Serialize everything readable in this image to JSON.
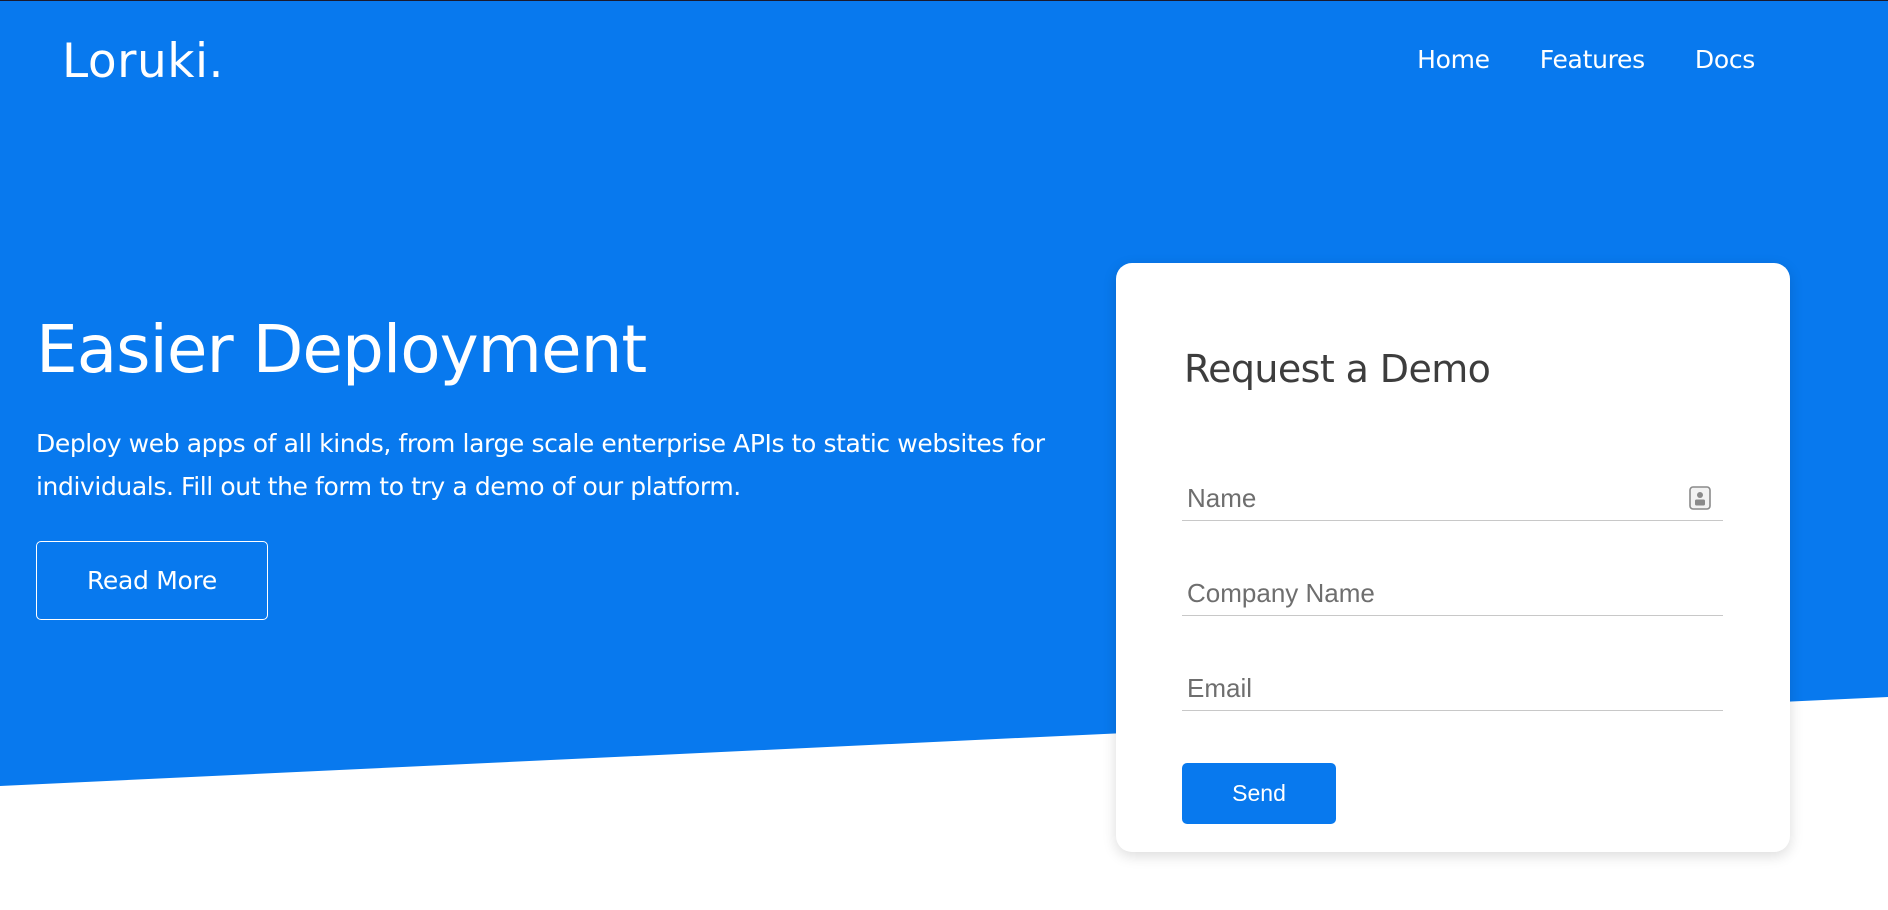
{
  "brand": {
    "name": "Loruki."
  },
  "nav": {
    "items": [
      {
        "label": "Home"
      },
      {
        "label": "Features"
      },
      {
        "label": "Docs"
      }
    ]
  },
  "hero": {
    "title": "Easier Deployment",
    "description": "Deploy web apps of all kinds, from large scale enterprise APIs to static websites for individuals. Fill out the form to try a demo of our platform.",
    "read_more_label": "Read More",
    "background_color": "#0879ee"
  },
  "form": {
    "title": "Request a Demo",
    "name_placeholder": "Name",
    "name_value": "",
    "company_placeholder": "Company Name",
    "company_value": "",
    "email_placeholder": "Email",
    "email_value": "",
    "send_label": "Send",
    "contact_icon": "contact-card-icon"
  },
  "colors": {
    "accent": "#0879ee",
    "text_on_accent": "#ffffff",
    "card_title": "#3d3d3d",
    "placeholder": "#6e6e6e"
  }
}
